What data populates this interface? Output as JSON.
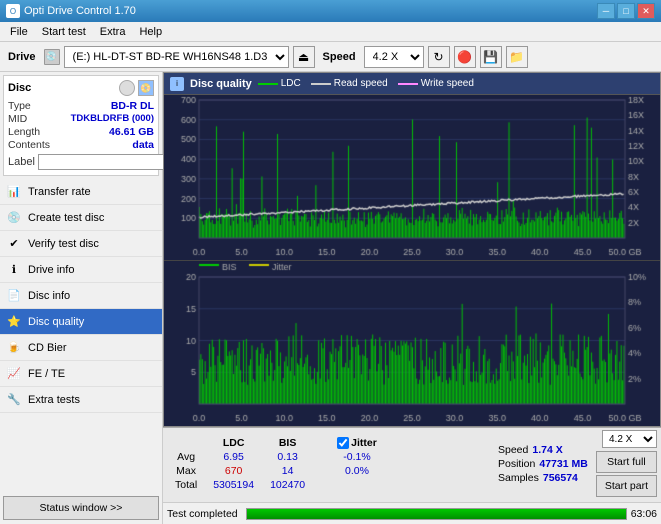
{
  "titleBar": {
    "title": "Opti Drive Control 1.70",
    "minimizeLabel": "─",
    "maximizeLabel": "□",
    "closeLabel": "✕"
  },
  "menuBar": {
    "items": [
      "File",
      "Start test",
      "Extra",
      "Help"
    ]
  },
  "toolbar": {
    "driveLabel": "Drive",
    "driveName": "(E:) HL-DT-ST BD-RE  WH16NS48 1.D3",
    "speedLabel": "Speed",
    "speedValue": "4.2 X"
  },
  "sidebar": {
    "discPanelTitle": "Disc",
    "discInfo": {
      "type": {
        "label": "Type",
        "value": "BD-R DL"
      },
      "mid": {
        "label": "MID",
        "value": "TDKBLDRFB (000)"
      },
      "length": {
        "label": "Length",
        "value": "46.61 GB"
      },
      "contents": {
        "label": "Contents",
        "value": "data"
      },
      "label": {
        "label": "Label",
        "value": ""
      }
    },
    "navItems": [
      {
        "id": "transfer-rate",
        "label": "Transfer rate",
        "icon": "📊",
        "active": false
      },
      {
        "id": "create-test-disc",
        "label": "Create test disc",
        "icon": "💿",
        "active": false
      },
      {
        "id": "verify-test-disc",
        "label": "Verify test disc",
        "icon": "✔",
        "active": false
      },
      {
        "id": "drive-info",
        "label": "Drive info",
        "icon": "ℹ",
        "active": false
      },
      {
        "id": "disc-info",
        "label": "Disc info",
        "icon": "📄",
        "active": false
      },
      {
        "id": "disc-quality",
        "label": "Disc quality",
        "icon": "⭐",
        "active": true
      },
      {
        "id": "cd-bier",
        "label": "CD Bier",
        "icon": "🍺",
        "active": false
      },
      {
        "id": "fe-te",
        "label": "FE / TE",
        "icon": "📈",
        "active": false
      },
      {
        "id": "extra-tests",
        "label": "Extra tests",
        "icon": "🔧",
        "active": false
      }
    ],
    "statusBtn": "Status window >>"
  },
  "chart": {
    "title": "Disc quality",
    "topChart": {
      "legend": [
        {
          "id": "ldc",
          "label": "LDC",
          "color": "#00cc00"
        },
        {
          "id": "read-speed",
          "label": "Read speed",
          "color": "#cccccc"
        },
        {
          "id": "write-speed",
          "label": "Write speed",
          "color": "#ff00ff"
        }
      ],
      "yMax": 700,
      "yAxisRight": [
        "18X",
        "16X",
        "14X",
        "12X",
        "10X",
        "8X",
        "6X",
        "4X",
        "2X"
      ],
      "xAxisLabels": [
        "0.0",
        "5.0",
        "10.0",
        "15.0",
        "20.0",
        "25.0",
        "30.0",
        "35.0",
        "40.0",
        "45.0",
        "50.0 GB"
      ]
    },
    "bottomChart": {
      "legend": [
        {
          "id": "bis",
          "label": "BIS",
          "color": "#00cc00"
        },
        {
          "id": "jitter",
          "label": "Jitter",
          "color": "#cccc00"
        }
      ],
      "yMax": 20,
      "yAxisRight": [
        "10%",
        "8%",
        "6%",
        "4%",
        "2%"
      ],
      "xAxisLabels": [
        "0.0",
        "5.0",
        "10.0",
        "15.0",
        "20.0",
        "25.0",
        "30.0",
        "35.0",
        "40.0",
        "45.0",
        "50.0 GB"
      ]
    }
  },
  "stats": {
    "columns": [
      "LDC",
      "BIS",
      "",
      "Jitter",
      "Speed",
      "1.74 X"
    ],
    "rows": {
      "avg": {
        "label": "Avg",
        "ldc": "6.95",
        "bis": "0.13",
        "sep": "",
        "jitter": "-0.1%",
        "speedLabel": "Position",
        "speedVal": "47731 MB"
      },
      "max": {
        "label": "Max",
        "ldc": "670",
        "bis": "14",
        "sep": "",
        "jitter": "0.0%",
        "posLabel": "",
        "posVal": ""
      },
      "total": {
        "label": "Total",
        "ldc": "5305194",
        "bis": "102470",
        "sep": "",
        "jitter": "",
        "samplesLabel": "Samples",
        "samplesVal": "756574"
      }
    },
    "speedSelectValue": "4.2 X",
    "startFull": "Start full",
    "startPart": "Start part",
    "jitterChecked": true,
    "jitterLabel": "Jitter"
  },
  "progress": {
    "statusText": "Test completed",
    "progressPercent": 100,
    "progressText": "63:06"
  }
}
